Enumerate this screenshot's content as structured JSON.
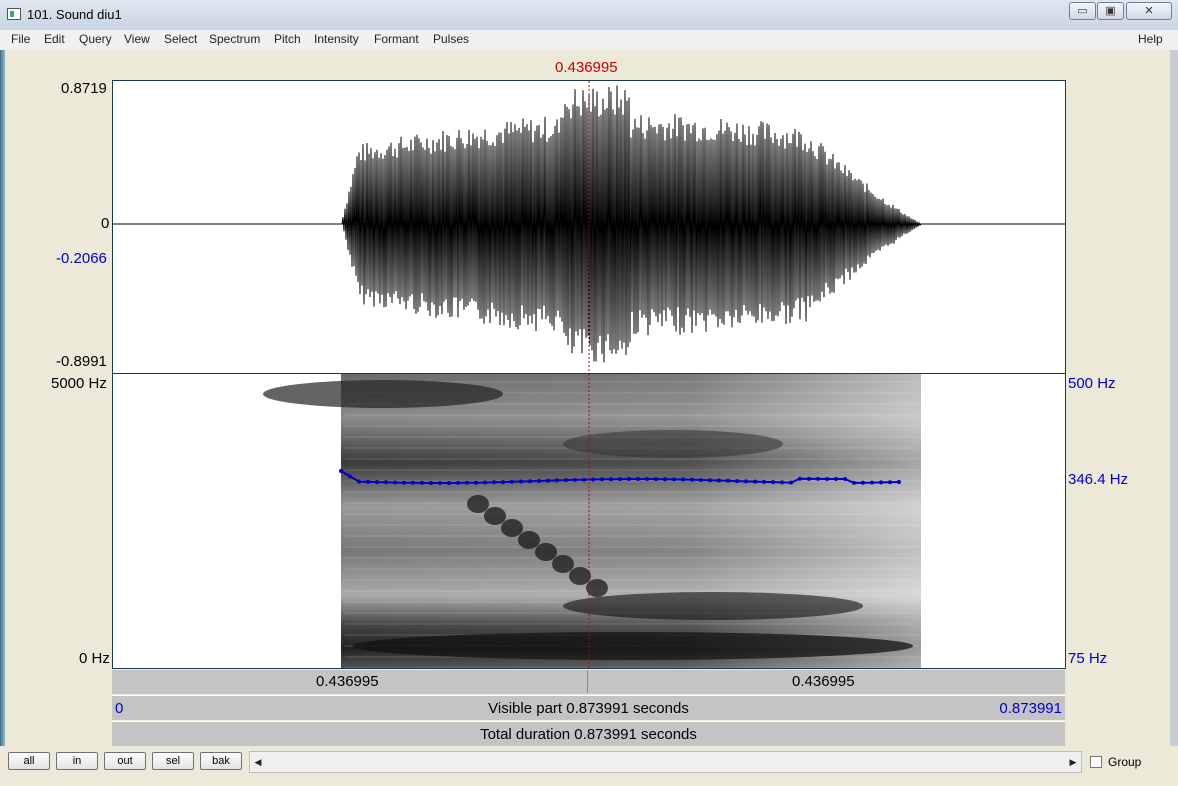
{
  "window": {
    "title": "101. Sound diu1",
    "controls": {
      "minimize": "▭",
      "maximize": "▣",
      "close": "✕"
    }
  },
  "menu": {
    "items": [
      "File",
      "Edit",
      "Query",
      "View",
      "Select",
      "Spectrum",
      "Pitch",
      "Intensity",
      "Formant",
      "Pulses"
    ],
    "help": "Help"
  },
  "cursor": {
    "time_label": "0.436995",
    "fraction": 0.5
  },
  "waveform": {
    "y_max_label": "0.8719",
    "y_zero_label": "0",
    "y_min_label": "-0.8991",
    "cursor_value_label": "-0.2066"
  },
  "spectrogram": {
    "freq_max_label": "5000 Hz",
    "freq_min_label": "0 Hz",
    "pitch_max_label": "500 Hz",
    "pitch_value_label": "346.4 Hz",
    "pitch_min_label": "75 Hz"
  },
  "time_bars": {
    "left_segment": "0.436995",
    "right_segment": "0.436995",
    "visible_start": "0",
    "visible_label": "Visible part 0.873991 seconds",
    "visible_end": "0.873991",
    "total_label": "Total duration 0.873991 seconds"
  },
  "buttons": {
    "all": "all",
    "in": "in",
    "out": "out",
    "sel": "sel",
    "bak": "bak"
  },
  "scroll": {
    "left_arrow": "◀",
    "right_arrow": "▶"
  },
  "group_checkbox": {
    "label": "Group",
    "checked": false
  },
  "colors": {
    "cursor": "#c80000",
    "pitch": "#0000c8",
    "waveform": "#000000"
  }
}
